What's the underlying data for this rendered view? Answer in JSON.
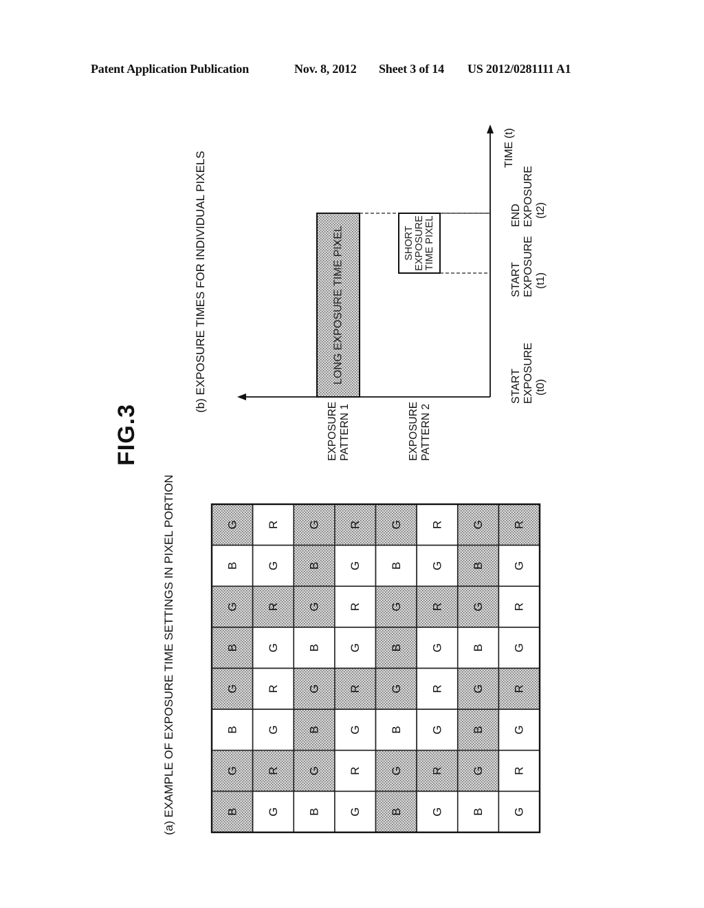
{
  "header": {
    "publication": "Patent Application Publication",
    "date": "Nov. 8, 2012",
    "sheet": "Sheet 3 of 14",
    "number": "US 2012/0281111 A1"
  },
  "figure": {
    "label": "FIG.3",
    "orientation": "rotated 90° counter-clockwise"
  },
  "panel_a": {
    "caption": "(a) EXAMPLE OF EXPOSURE TIME SETTINGS IN PIXEL PORTION",
    "legend": {
      "shaded": "long exposure time pixel",
      "white": "short exposure time pixel"
    },
    "columns_note": "columns listed page-top to page-bottom; cells listed page-left to page-right",
    "grid": [
      [
        {
          "c": "G",
          "s": true
        },
        {
          "c": "R",
          "s": false
        },
        {
          "c": "G",
          "s": true
        },
        {
          "c": "R",
          "s": true
        },
        {
          "c": "G",
          "s": true
        },
        {
          "c": "R",
          "s": false
        },
        {
          "c": "G",
          "s": true
        },
        {
          "c": "R",
          "s": true
        }
      ],
      [
        {
          "c": "B",
          "s": false
        },
        {
          "c": "G",
          "s": false
        },
        {
          "c": "B",
          "s": true
        },
        {
          "c": "G",
          "s": false
        },
        {
          "c": "B",
          "s": false
        },
        {
          "c": "G",
          "s": false
        },
        {
          "c": "B",
          "s": true
        },
        {
          "c": "G",
          "s": false
        }
      ],
      [
        {
          "c": "G",
          "s": true
        },
        {
          "c": "R",
          "s": true
        },
        {
          "c": "G",
          "s": true
        },
        {
          "c": "R",
          "s": false
        },
        {
          "c": "G",
          "s": true
        },
        {
          "c": "R",
          "s": true
        },
        {
          "c": "G",
          "s": true
        },
        {
          "c": "R",
          "s": false
        }
      ],
      [
        {
          "c": "B",
          "s": true
        },
        {
          "c": "G",
          "s": false
        },
        {
          "c": "B",
          "s": false
        },
        {
          "c": "G",
          "s": false
        },
        {
          "c": "B",
          "s": true
        },
        {
          "c": "G",
          "s": false
        },
        {
          "c": "B",
          "s": false
        },
        {
          "c": "G",
          "s": false
        }
      ],
      [
        {
          "c": "G",
          "s": true
        },
        {
          "c": "R",
          "s": false
        },
        {
          "c": "G",
          "s": true
        },
        {
          "c": "R",
          "s": true
        },
        {
          "c": "G",
          "s": true
        },
        {
          "c": "R",
          "s": false
        },
        {
          "c": "G",
          "s": true
        },
        {
          "c": "R",
          "s": true
        }
      ],
      [
        {
          "c": "B",
          "s": false
        },
        {
          "c": "G",
          "s": false
        },
        {
          "c": "B",
          "s": true
        },
        {
          "c": "G",
          "s": false
        },
        {
          "c": "B",
          "s": false
        },
        {
          "c": "G",
          "s": false
        },
        {
          "c": "B",
          "s": true
        },
        {
          "c": "G",
          "s": false
        }
      ],
      [
        {
          "c": "G",
          "s": true
        },
        {
          "c": "R",
          "s": true
        },
        {
          "c": "G",
          "s": true
        },
        {
          "c": "R",
          "s": false
        },
        {
          "c": "G",
          "s": true
        },
        {
          "c": "R",
          "s": true
        },
        {
          "c": "G",
          "s": true
        },
        {
          "c": "R",
          "s": false
        }
      ],
      [
        {
          "c": "B",
          "s": true
        },
        {
          "c": "G",
          "s": false
        },
        {
          "c": "B",
          "s": false
        },
        {
          "c": "G",
          "s": false
        },
        {
          "c": "B",
          "s": true
        },
        {
          "c": "G",
          "s": false
        },
        {
          "c": "B",
          "s": false
        },
        {
          "c": "G",
          "s": false
        }
      ]
    ]
  },
  "panel_b": {
    "caption": "(b) EXPOSURE TIMES FOR INDIVIDUAL PIXELS",
    "time_axis_label": "TIME (t)",
    "patterns": [
      {
        "label_line1": "EXPOSURE",
        "label_line2": "PATTERN 1",
        "bar_text": "LONG EXPOSURE TIME PIXEL",
        "bar_lines": [
          "LONG EXPOSURE TIME PIXEL"
        ],
        "start": "t0",
        "end": "t2",
        "shaded": true
      },
      {
        "label_line1": "EXPOSURE",
        "label_line2": "PATTERN 2",
        "bar_text": "SHORT EXPOSURE TIME PIXEL",
        "bar_lines": [
          "SHORT",
          "EXPOSURE",
          "TIME PIXEL"
        ],
        "start": "t1",
        "end": "t2",
        "shaded": false
      }
    ],
    "time_marks": [
      {
        "id": "t0",
        "lines": [
          "START",
          "EXPOSURE",
          "(t0)"
        ]
      },
      {
        "id": "t1",
        "lines": [
          "START",
          "EXPOSURE",
          "(t1)"
        ]
      },
      {
        "id": "t2",
        "lines": [
          "END",
          "EXPOSURE",
          "(t2)"
        ]
      }
    ]
  }
}
